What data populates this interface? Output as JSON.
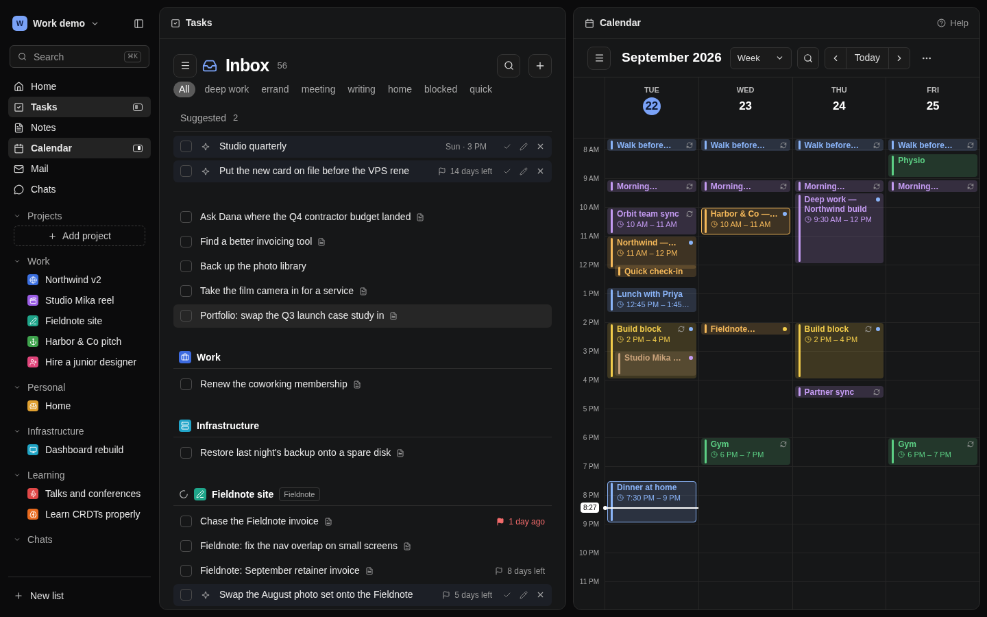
{
  "sidebar": {
    "workspace": {
      "initial": "W",
      "name": "Work demo"
    },
    "search": {
      "placeholder": "Search",
      "shortcut": "⌘K"
    },
    "nav": [
      {
        "label": "Home",
        "selected": false,
        "kind": "plain"
      },
      {
        "label": "Tasks",
        "selected": true,
        "kind": "left"
      },
      {
        "label": "Notes",
        "selected": false,
        "kind": "plain"
      },
      {
        "label": "Calendar",
        "selected": true,
        "kind": "right"
      },
      {
        "label": "Mail",
        "selected": false,
        "kind": "plain"
      },
      {
        "label": "Chats",
        "selected": false,
        "kind": "plain"
      }
    ],
    "sections": [
      {
        "title": "Projects",
        "expanded": true,
        "add_label": "Add project"
      },
      {
        "title": "Work",
        "expanded": true,
        "items": [
          {
            "label": "Northwind v2",
            "color": "#3b6fe0"
          },
          {
            "label": "Studio Mika reel",
            "color": "#9b5de5"
          },
          {
            "label": "Fieldnote site",
            "color": "#1fa58a"
          },
          {
            "label": "Harbor & Co pitch",
            "color": "#3fa34d"
          },
          {
            "label": "Hire a junior designer",
            "color": "#e0457b"
          }
        ]
      },
      {
        "title": "Personal",
        "expanded": true,
        "items": [
          {
            "label": "Home",
            "color": "#e0a030"
          }
        ]
      },
      {
        "title": "Infrastructure",
        "expanded": true,
        "items": [
          {
            "label": "Dashboard rebuild",
            "color": "#1fa3c4"
          }
        ]
      },
      {
        "title": "Learning",
        "expanded": true,
        "items": [
          {
            "label": "Talks and conferences",
            "color": "#e04848"
          },
          {
            "label": "Learn CRDTs properly",
            "color": "#e86a1e"
          }
        ]
      },
      {
        "title": "Chats",
        "expanded": true
      }
    ],
    "new_list": "New list"
  },
  "tasks": {
    "title": "Tasks",
    "list_title": "Inbox",
    "count": "56",
    "filters": [
      {
        "label": "All",
        "selected": true
      },
      {
        "label": "deep work",
        "selected": false
      },
      {
        "label": "errand",
        "selected": false
      },
      {
        "label": "meeting",
        "selected": false
      },
      {
        "label": "writing",
        "selected": false
      },
      {
        "label": "home",
        "selected": false
      },
      {
        "label": "blocked",
        "selected": false
      },
      {
        "label": "quick",
        "selected": false
      }
    ],
    "suggested": {
      "label": "Suggested",
      "count": "2",
      "items": [
        {
          "kind": "suggested",
          "title": "Studio quarterly",
          "checked": false,
          "meta": "Sun · 3 PM"
        },
        {
          "kind": "suggested",
          "title": "Put the new card on file before the VPS rene",
          "checked": false,
          "due": {
            "text": "14 days left",
            "overdue": false
          }
        }
      ]
    },
    "inbox": [
      {
        "kind": "task",
        "title": "Ask Dana where the Q4 contractor budget landed",
        "checked": false,
        "note": true,
        "hovered": false
      },
      {
        "kind": "task",
        "title": "Find a better invoicing tool",
        "checked": false,
        "note": true,
        "hovered": false
      },
      {
        "kind": "task",
        "title": "Back up the photo library",
        "checked": false,
        "note": false,
        "hovered": false
      },
      {
        "kind": "task",
        "title": "Take the film camera in for a service",
        "checked": false,
        "note": true,
        "hovered": false
      },
      {
        "kind": "task",
        "title": "Portfolio: swap the Q3 launch case study in",
        "checked": false,
        "note": true,
        "hovered": true
      }
    ],
    "groups": [
      {
        "title": "Work",
        "color": "#3d6be0",
        "syncing": false,
        "items": [
          {
            "kind": "task",
            "title": "Renew the coworking membership",
            "checked": false,
            "note": true,
            "hovered": false
          }
        ]
      },
      {
        "title": "Infrastructure",
        "color": "#22a5c9",
        "syncing": false,
        "items": [
          {
            "kind": "task",
            "title": "Restore last night's backup onto a spare disk",
            "checked": false,
            "note": true,
            "hovered": false
          }
        ]
      },
      {
        "title": "Fieldnote site",
        "color": "#1fa58a",
        "syncing": true,
        "tag": "Fieldnote",
        "items": [
          {
            "kind": "task",
            "title": "Chase the Fieldnote invoice",
            "checked": false,
            "note": true,
            "hovered": false,
            "due": {
              "text": "1 day ago",
              "overdue": true
            }
          },
          {
            "kind": "task",
            "title": "Fieldnote: fix the nav overlap on small screens",
            "checked": false,
            "note": true,
            "hovered": false
          },
          {
            "kind": "task",
            "title": "Fieldnote: September retainer invoice",
            "checked": false,
            "note": true,
            "hovered": false,
            "due": {
              "text": "8 days left",
              "overdue": false
            }
          },
          {
            "kind": "suggested",
            "title": "Swap the August photo set onto the Fieldnote",
            "checked": false,
            "due": {
              "text": "5 days left",
              "overdue": false
            }
          }
        ]
      }
    ]
  },
  "calendar": {
    "title": "Calendar",
    "help": "Help",
    "month": "September 2026",
    "view": "Week",
    "today_button": "Today",
    "now_label": "8:27",
    "hours": [
      "8 AM",
      "9 AM",
      "10 AM",
      "11 AM",
      "12 PM",
      "1 PM",
      "2 PM",
      "3 PM",
      "4 PM",
      "5 PM",
      "6 PM",
      "7 PM",
      "8 PM",
      "9 PM",
      "10 PM",
      "11 PM"
    ],
    "days": [
      {
        "weekday": "TUE",
        "date": "22",
        "today": true,
        "events": [
          {
            "title": "Walk before…",
            "color": "#8ab4f8",
            "recurring": true,
            "highlighted": false
          },
          {
            "title": "Morning…",
            "color": "#c49bf2",
            "recurring": true,
            "highlighted": false
          },
          {
            "title": "Orbit team sync",
            "time": "10 AM – 11 AM",
            "color": "#c49bf2",
            "recurring": true,
            "highlighted": false
          },
          {
            "title": "Northwind —…",
            "time": "11 AM – 12 PM",
            "color": "#f5b95a",
            "recurring": false,
            "highlighted": false,
            "dot": {
              "color": "#8ab4f8"
            }
          },
          {
            "title": "Quick check-in",
            "color": "#f5b95a",
            "recurring": false,
            "highlighted": false
          },
          {
            "title": "Lunch with Priya",
            "time": "12:45 PM – 1:45…",
            "color": "#8ab4f8",
            "recurring": false,
            "highlighted": false
          },
          {
            "title": "Build block",
            "time": "2 PM – 4 PM",
            "color": "#f2cc4b",
            "recurring": true,
            "highlighted": false,
            "dot": {
              "color": "#8ab4f8"
            }
          },
          {
            "title": "Studio Mika …",
            "color": "#c9a27a",
            "recurring": false,
            "highlighted": false,
            "dot": {
              "color": "#c49bf2"
            }
          },
          {
            "title": "Dinner at home",
            "time": "7:30 PM – 9 PM",
            "color": "#8ab4f8",
            "recurring": false,
            "highlighted": true
          }
        ]
      },
      {
        "weekday": "WED",
        "date": "23",
        "today": false,
        "events": [
          {
            "title": "Walk before…",
            "color": "#8ab4f8",
            "recurring": true,
            "highlighted": false
          },
          {
            "title": "Morning…",
            "color": "#c49bf2",
            "recurring": true,
            "highlighted": false
          },
          {
            "title": "Harbor & Co —…",
            "time": "10 AM – 11 AM",
            "color": "#f5b95a",
            "recurring": false,
            "highlighted": true,
            "dot": {
              "color": "#8ab4f8"
            }
          },
          {
            "title": "Fieldnote…",
            "color": "#f5b95a",
            "recurring": false,
            "highlighted": false,
            "dot": {
              "color": "#f2cc4b"
            }
          },
          {
            "title": "Gym",
            "time": "6 PM – 7 PM",
            "color": "#5ccf84",
            "recurring": true,
            "highlighted": false
          }
        ]
      },
      {
        "weekday": "THU",
        "date": "24",
        "today": false,
        "events": [
          {
            "title": "Walk before…",
            "color": "#8ab4f8",
            "recurring": true,
            "highlighted": false
          },
          {
            "title": "Morning…",
            "color": "#c49bf2",
            "recurring": true,
            "highlighted": false
          },
          {
            "title": "Deep work — Northwind build",
            "time": "9:30 AM – 12 PM",
            "color": "#c49bf2",
            "recurring": false,
            "highlighted": false,
            "dot": {
              "color": "#8ab4f8"
            }
          },
          {
            "title": "Build block",
            "time": "2 PM – 4 PM",
            "color": "#f2cc4b",
            "recurring": true,
            "highlighted": false,
            "dot": {
              "color": "#8ab4f8"
            }
          },
          {
            "title": "Partner sync",
            "color": "#c49bf2",
            "recurring": true,
            "highlighted": false
          }
        ]
      },
      {
        "weekday": "FRI",
        "date": "25",
        "today": false,
        "events": [
          {
            "title": "Walk before…",
            "color": "#8ab4f8",
            "recurring": true,
            "highlighted": false
          },
          {
            "title": "Physio",
            "color": "#5ccf84",
            "recurring": false,
            "highlighted": false
          },
          {
            "title": "Morning…",
            "color": "#c49bf2",
            "recurring": true,
            "highlighted": false
          },
          {
            "title": "Gym",
            "time": "6 PM – 7 PM",
            "color": "#5ccf84",
            "recurring": true,
            "highlighted": false
          }
        ]
      }
    ]
  }
}
